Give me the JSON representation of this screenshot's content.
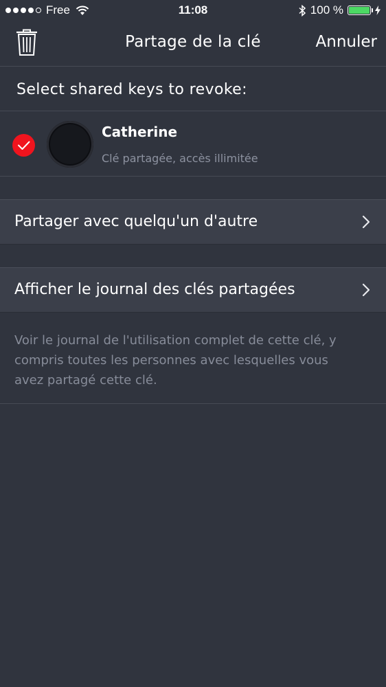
{
  "status_bar": {
    "carrier": "Free",
    "time": "11:08",
    "battery": "100 %",
    "signal_bars": 4,
    "icons": [
      "signal-dots-icon",
      "wifi-icon",
      "bluetooth-icon",
      "battery-icon",
      "charging-bolt-icon"
    ]
  },
  "nav": {
    "title": "Partage de la clé",
    "cancel": "Annuler",
    "left_icon": "trash-icon"
  },
  "section": {
    "header": "Select shared keys to revoke:"
  },
  "shared_keys": [
    {
      "name": "Catherine",
      "subtitle": "Clé partagée, accès illimitée",
      "selected": true
    }
  ],
  "rows": {
    "share_label": "Partager avec quelqu'un d'autre",
    "log_label": "Afficher le journal des clés partagées"
  },
  "footer": {
    "text": "Voir le journal de l'utilisation complet de cette clé, y compris toutes les personnes avec lesquelles vous avez partagé cette clé."
  },
  "colors": {
    "background": "#30343e",
    "row_background": "#3b3f4a",
    "accent_red": "#f0141e",
    "battery_green": "#4cd964",
    "secondary_text": "#8d92a0"
  }
}
